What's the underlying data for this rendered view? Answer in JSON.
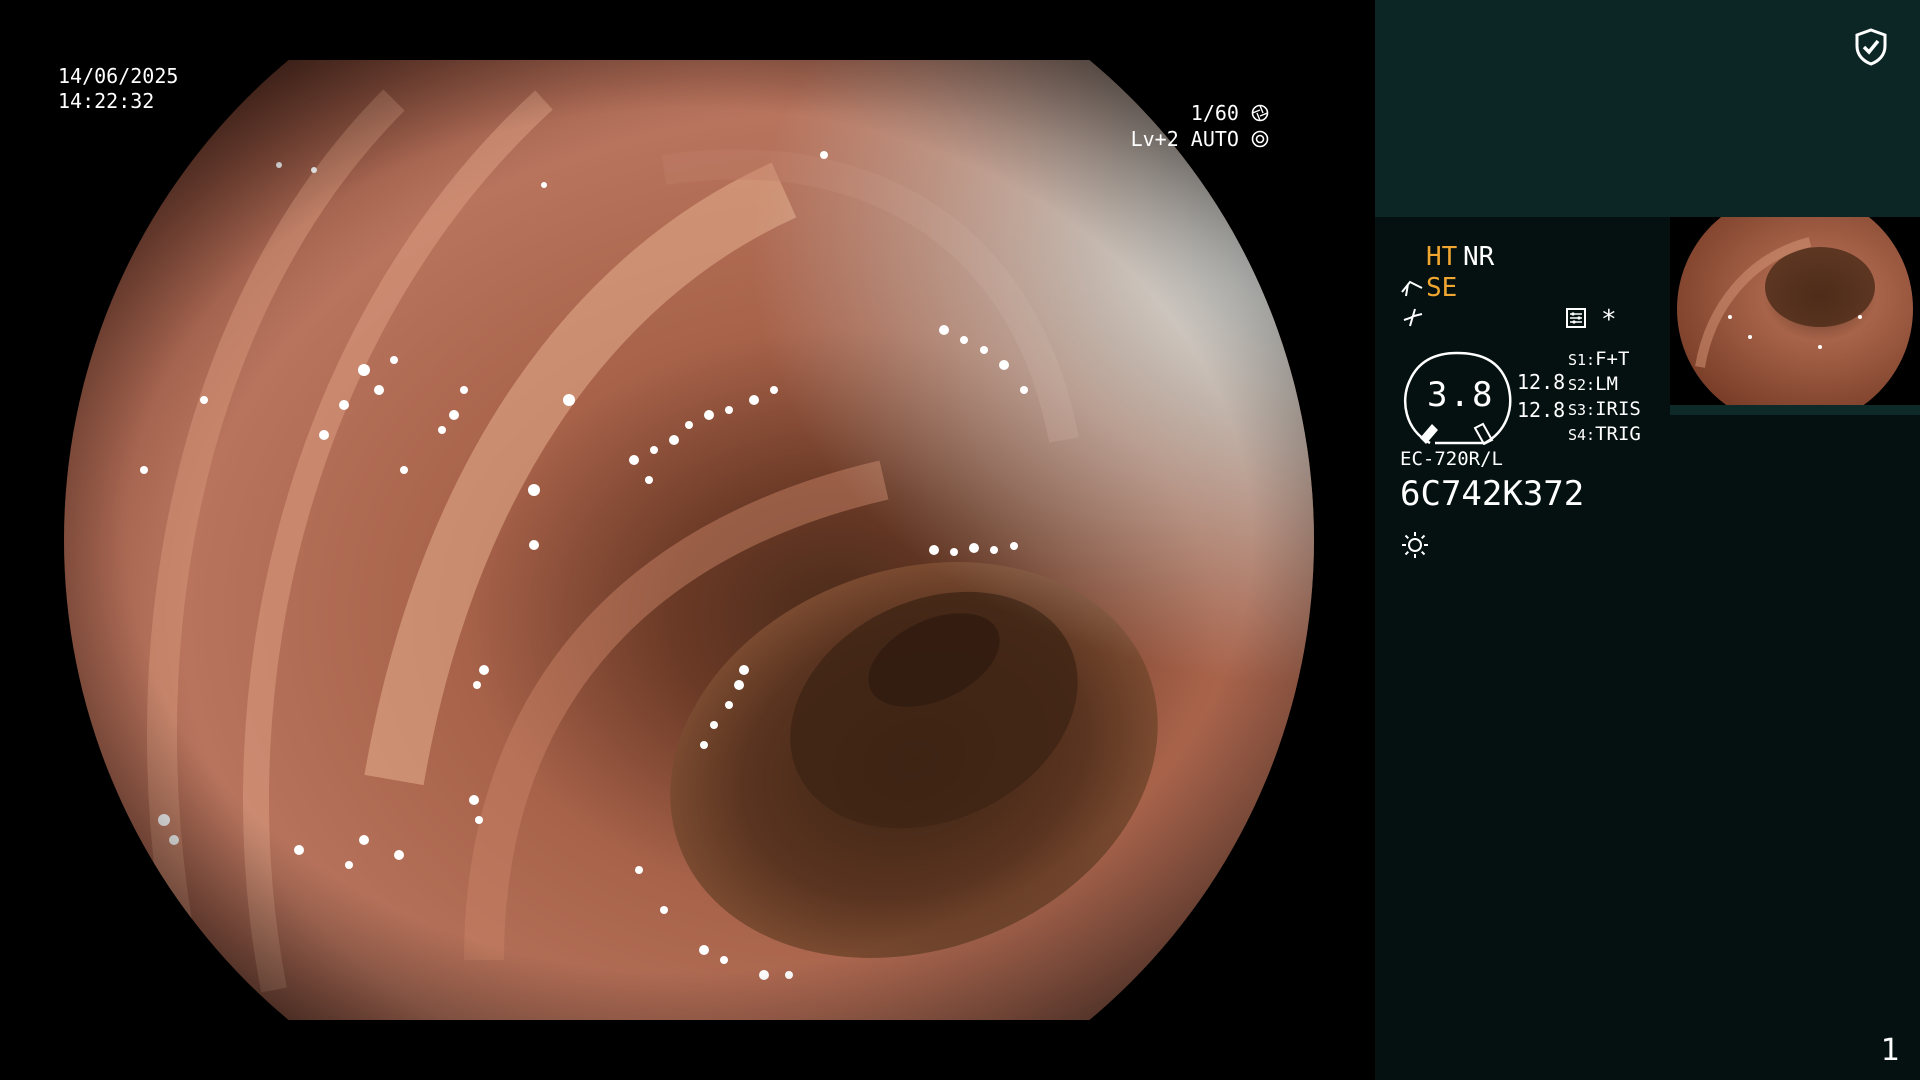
{
  "osd": {
    "date": "14/06/2025",
    "time": "14:22:32",
    "shutter": "1/60",
    "light_level": "Lv+2 AUTO"
  },
  "panel": {
    "ht": "HT",
    "nr": "NR",
    "se": "SE",
    "asterisk": "*",
    "gauge_value": "3.8",
    "gauge_num1": "12.8",
    "gauge_num2": "12.8",
    "switches": [
      {
        "key": "S1:",
        "value": "F+T"
      },
      {
        "key": "S2:",
        "value": "LM"
      },
      {
        "key": "S3:",
        "value": "IRIS"
      },
      {
        "key": "S4:",
        "value": "TRIG"
      }
    ],
    "model": "EC-720R/L",
    "serial": "6C742K372",
    "page_number": "1"
  },
  "colors": {
    "accent_orange": "#f0a630",
    "panel_bg": "#041110",
    "panel_top_bg": "#0b2625"
  },
  "icons": [
    "shield-check-icon",
    "scope-angle-icon",
    "curve-icon",
    "settings-list-icon",
    "sun-icon",
    "shutter-icon",
    "iris-icon"
  ]
}
